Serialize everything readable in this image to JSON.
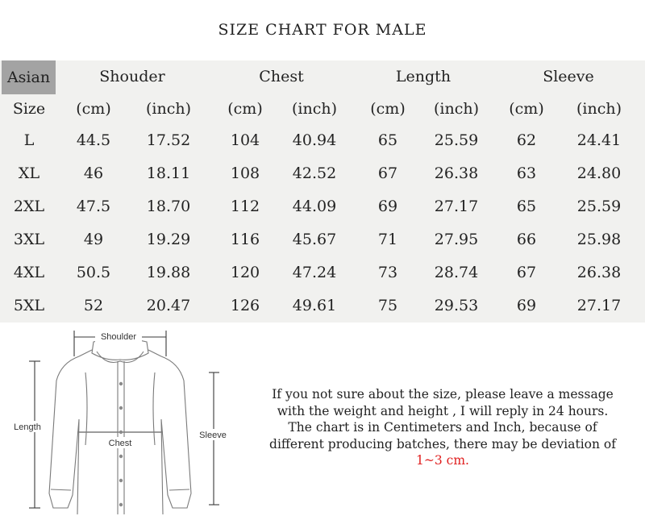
{
  "title": "SIZE CHART FOR MALE",
  "table": {
    "corner": "Asian",
    "size_label": "Size",
    "groups": [
      "Shouder",
      "Chest",
      "Length",
      "Sleeve"
    ],
    "units": [
      "(cm)",
      "(inch)",
      "(cm)",
      "(inch)",
      "(cm)",
      "(inch)",
      "(cm)",
      "(inch)"
    ],
    "rows": [
      [
        "L",
        "44.5",
        "17.52",
        "104",
        "40.94",
        "65",
        "25.59",
        "62",
        "24.41"
      ],
      [
        "XL",
        "46",
        "18.11",
        "108",
        "42.52",
        "67",
        "26.38",
        "63",
        "24.80"
      ],
      [
        "2XL",
        "47.5",
        "18.70",
        "112",
        "44.09",
        "69",
        "27.17",
        "65",
        "25.59"
      ],
      [
        "3XL",
        "49",
        "19.29",
        "116",
        "45.67",
        "71",
        "27.95",
        "66",
        "25.98"
      ],
      [
        "4XL",
        "50.5",
        "19.88",
        "120",
        "47.24",
        "73",
        "28.74",
        "67",
        "26.38"
      ],
      [
        "5XL",
        "52",
        "20.47",
        "126",
        "49.61",
        "75",
        "29.53",
        "69",
        "27.17"
      ]
    ]
  },
  "diagram": {
    "shoulder": "Shoulder",
    "chest": "Chest",
    "length": "Length",
    "sleeve": "Sleeve"
  },
  "note": {
    "line1": "If you not sure about the size, please leave a message",
    "line2": "with the weight and height , I will reply in 24 hours.",
    "line3": "The chart is in Centimeters and Inch, because of",
    "line4": "different producing batches, there may be deviation of",
    "line5": "1~3 cm."
  },
  "colors": {
    "table_bg": "#f1f1ef",
    "corner_bg": "#a3a3a3",
    "note_highlight": "#e02020"
  }
}
